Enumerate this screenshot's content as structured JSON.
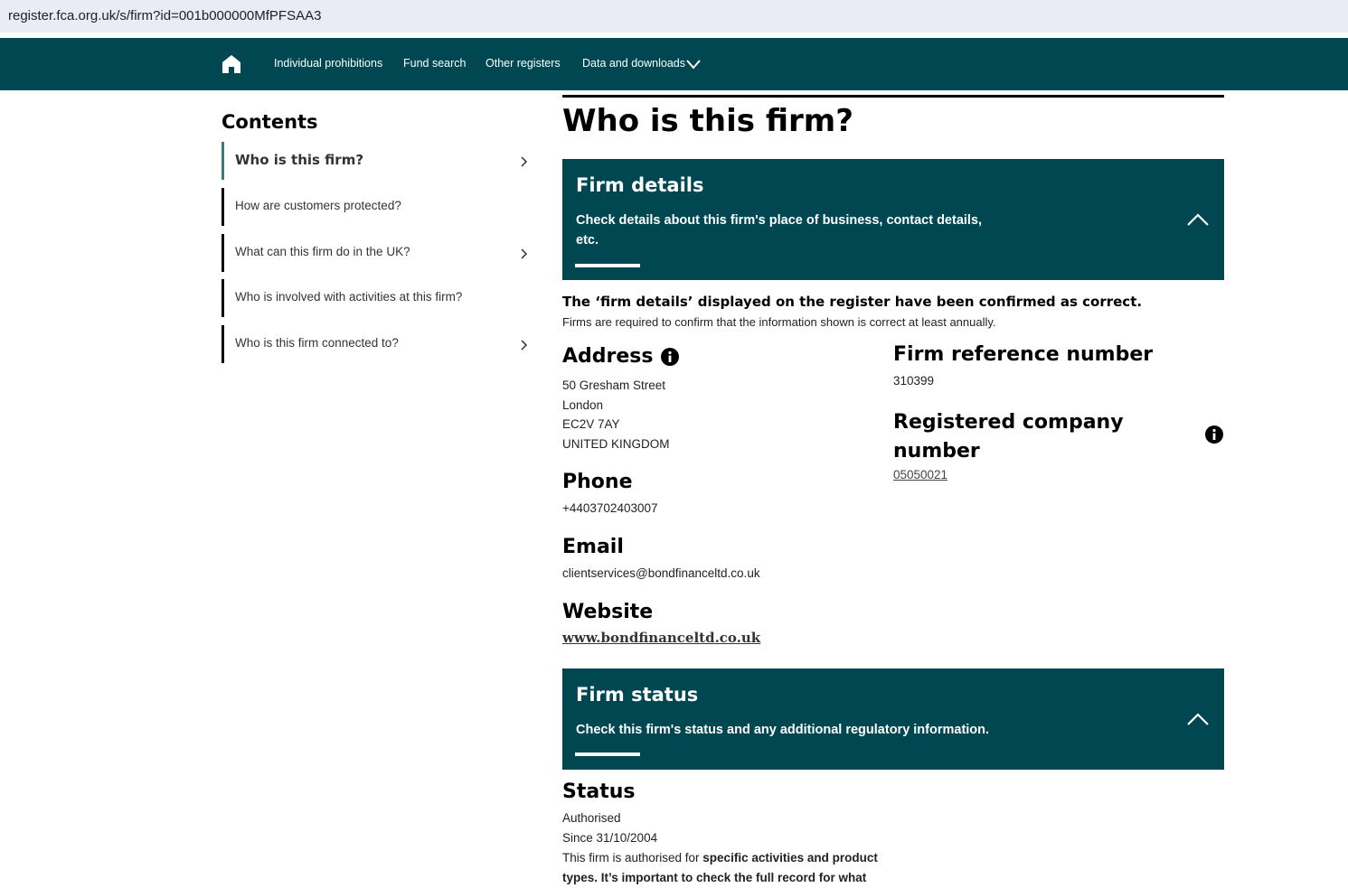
{
  "browser": {
    "url": "register.fca.org.uk/s/firm?id=001b000000MfPFSAA3"
  },
  "nav": {
    "home_icon": "home-icon",
    "links": [
      "Individual prohibitions",
      "Fund search",
      "Other registers",
      "Data and downloads"
    ],
    "dropdown_icon": "chevron-down-icon"
  },
  "contents": {
    "title": "Contents",
    "items": [
      {
        "label": "Who is this firm?",
        "active": true,
        "has_chevron": true
      },
      {
        "label": "How are customers protected?",
        "active": false,
        "has_chevron": false
      },
      {
        "label": "What can this firm do in the UK?",
        "active": false,
        "has_chevron": true
      },
      {
        "label": "Who is involved with activities at this firm?",
        "active": false,
        "has_chevron": false
      },
      {
        "label": "Who is this firm connected to?",
        "active": false,
        "has_chevron": true
      }
    ]
  },
  "main": {
    "title": "Who is this firm?",
    "firm_details": {
      "title": "Firm details",
      "desc_line1": "Check details about this firm's place of business, contact details,",
      "desc_line2": "etc."
    },
    "confirm_bold": "The ‘firm details’ displayed on the register have been confirmed as correct.",
    "confirm_sub": "Firms are required to confirm that the information shown is correct at least annually.",
    "address": {
      "heading": "Address",
      "lines": [
        "50 Gresham Street",
        "London",
        "EC2V 7AY",
        "UNITED KINGDOM"
      ]
    },
    "phone": {
      "heading": "Phone",
      "value": "+4403702403007"
    },
    "email": {
      "heading": "Email",
      "value": "clientservices@bondfinanceltd.co.uk"
    },
    "website": {
      "heading": "Website",
      "value": "www.bondfinanceltd.co.uk"
    },
    "frn": {
      "heading": "Firm reference number",
      "value": "310399"
    },
    "company_number": {
      "heading_line1": "Registered company",
      "heading_line2": "number",
      "value": "05050021"
    },
    "firm_status": {
      "title": "Firm status",
      "desc": "Check this firm's status and any additional regulatory information."
    },
    "status": {
      "heading": "Status",
      "value": "Authorised",
      "since": "Since 31/10/2004",
      "text_plain": "This firm is authorised for ",
      "text_bold": "specific activities and product types. It’s important to check the full record for what"
    }
  },
  "colors": {
    "brand_teal": "#014751",
    "active_marker": "#3d7a7a"
  }
}
